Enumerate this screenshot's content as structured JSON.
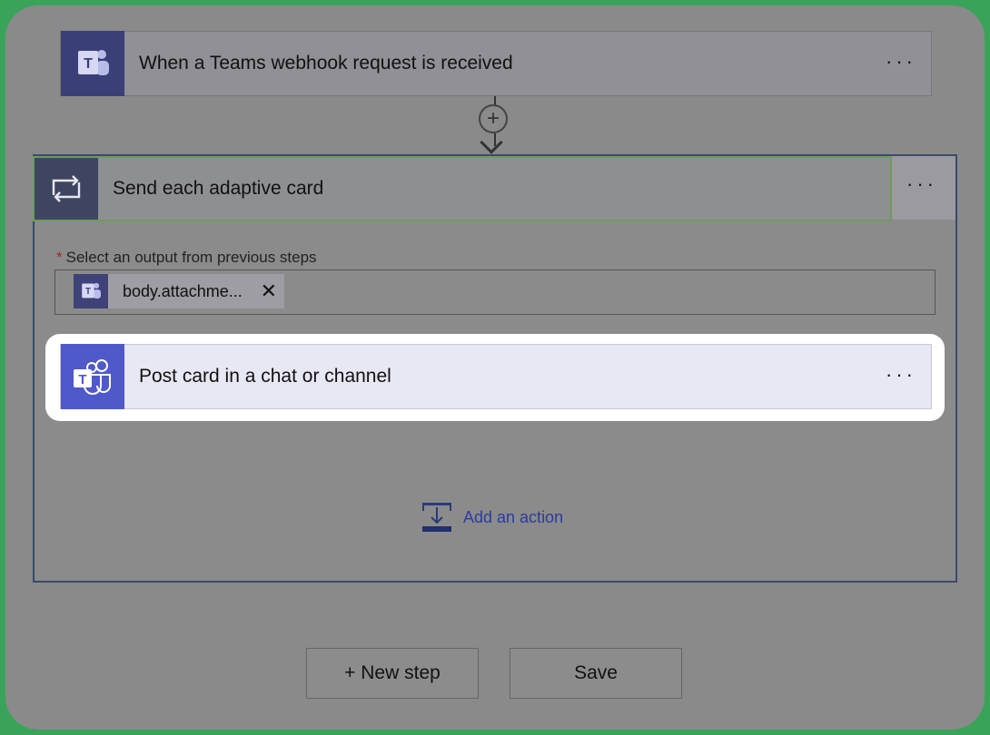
{
  "trigger": {
    "title": "When a Teams webhook request is received",
    "menu": "···"
  },
  "connector": {
    "plus": "+"
  },
  "scope": {
    "title": "Send each adaptive card",
    "menu": "···",
    "field_label": "Select an output from previous steps",
    "required_marker": "*",
    "token": {
      "label": "body.attachme...",
      "close": "✕"
    }
  },
  "action": {
    "title": "Post card in a chat or channel",
    "menu": "···"
  },
  "add_action": {
    "label": "Add an action"
  },
  "footer": {
    "new_step": "+ New step",
    "save": "Save"
  },
  "colors": {
    "teams_purple": "#5059c9",
    "link_blue": "#2b3ba0",
    "required_red": "#a4262c",
    "outer_green": "#3aa35a"
  }
}
